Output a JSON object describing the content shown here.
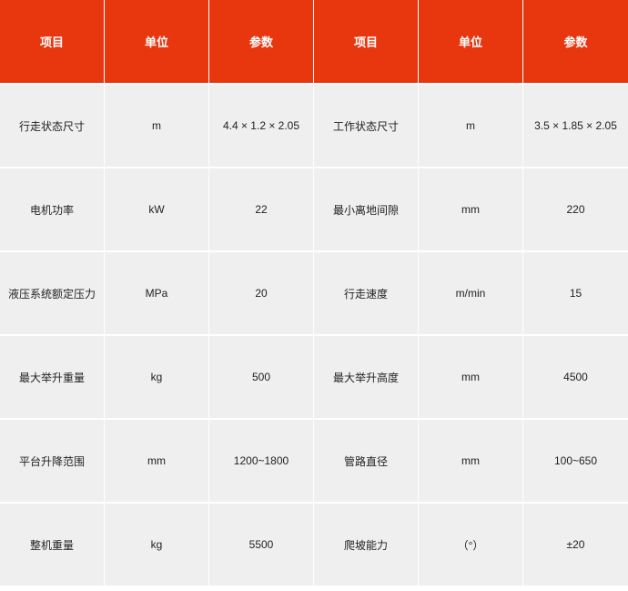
{
  "table": {
    "headers": [
      "项目",
      "单位",
      "参数",
      "项目",
      "单位",
      "参数"
    ],
    "rows": [
      [
        "行走状态尺寸",
        "m",
        "4.4 × 1.2 × 2.05",
        "工作状态尺寸",
        "m",
        "3.5 × 1.85 × 2.05"
      ],
      [
        "电机功率",
        "kW",
        "22",
        "最小离地间隙",
        "mm",
        "220"
      ],
      [
        "液压系统额定压力",
        "MPa",
        "20",
        "行走速度",
        "m/min",
        "15"
      ],
      [
        "最大举升重量",
        "kg",
        "500",
        "最大举升高度",
        "mm",
        "4500"
      ],
      [
        "平台升降范围",
        "mm",
        "1200~1800",
        "管路直径",
        "mm",
        "100~650"
      ],
      [
        "整机重量",
        "kg",
        "5500",
        "爬坡能力",
        "（°）",
        "±20"
      ]
    ]
  },
  "colors": {
    "header_bg": "#e8360f",
    "cell_bg": "#efefef"
  }
}
